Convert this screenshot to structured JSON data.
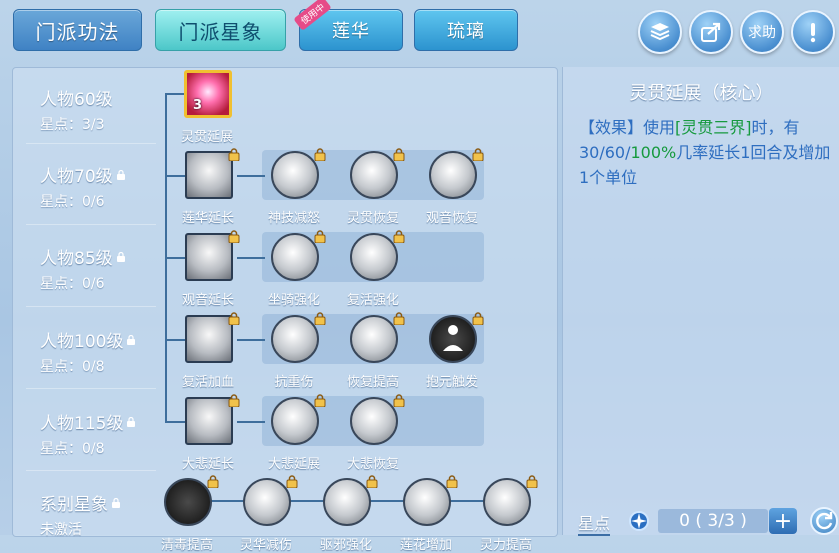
{
  "tabs": [
    {
      "label": "门派功法"
    },
    {
      "label": "门派星象"
    },
    {
      "label": "莲华",
      "badge": "使用中"
    },
    {
      "label": "琉璃"
    }
  ],
  "top_buttons": {
    "help_label": "求助"
  },
  "levels": [
    {
      "title": "人物60级",
      "stars": "星点：3/3",
      "locked": false
    },
    {
      "title": "人物70级",
      "stars": "星点：0/6",
      "locked": true
    },
    {
      "title": "人物85级",
      "stars": "星点：0/6",
      "locked": true
    },
    {
      "title": "人物100级",
      "stars": "星点：0/8",
      "locked": true
    },
    {
      "title": "人物115级",
      "stars": "星点：0/8",
      "locked": true
    },
    {
      "title": "系别星象",
      "stars": "未激活",
      "locked": true
    }
  ],
  "nodes": {
    "row1": [
      {
        "label": "灵贯延展",
        "count": "3"
      }
    ],
    "row2": [
      {
        "label": "莲华延长"
      },
      {
        "label": "神技减怒"
      },
      {
        "label": "灵贯恢复"
      },
      {
        "label": "观音恢复"
      }
    ],
    "row3": [
      {
        "label": "观音延长"
      },
      {
        "label": "坐骑强化"
      },
      {
        "label": "复活强化"
      }
    ],
    "row4": [
      {
        "label": "复活加血"
      },
      {
        "label": "抗重伤"
      },
      {
        "label": "恢复提高"
      },
      {
        "label": "抱元触发"
      }
    ],
    "row5": [
      {
        "label": "大悲延长"
      },
      {
        "label": "大悲延展"
      },
      {
        "label": "大悲恢复"
      }
    ],
    "row6": [
      {
        "label": "清毒提高"
      },
      {
        "label": "灵华减伤"
      },
      {
        "label": "驱邪强化"
      },
      {
        "label": "莲花增加"
      },
      {
        "label": "灵力提高"
      }
    ]
  },
  "info": {
    "title": "灵贯延展（核心）",
    "effect_tag": "【效果】",
    "text1": "使用",
    "skill": "[灵贯三界]",
    "text2": "时，有30/60/",
    "pct": "100%",
    "text3": "几率延长1回合及增加1个单位"
  },
  "footer": {
    "label": "星点",
    "value": "0 ( 3/3 )",
    "plus": "+"
  },
  "colors": {
    "accent": "#3f82c4",
    "active_tab": "#4cc7c9",
    "highlight": "#169a3e",
    "info_text": "#2e6ec0"
  }
}
